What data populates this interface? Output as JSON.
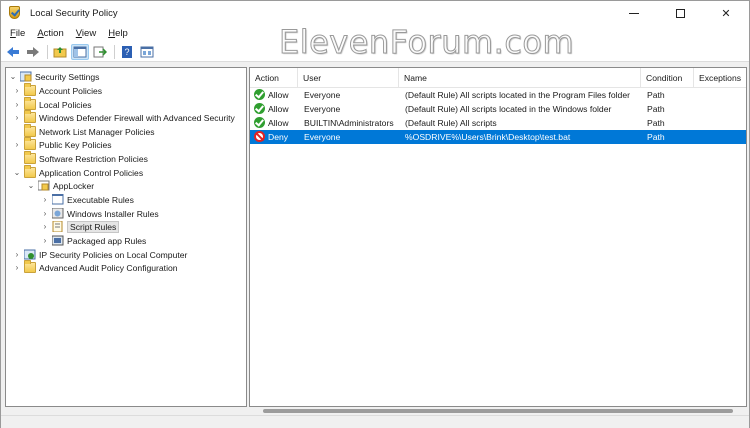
{
  "window": {
    "title": "Local Security Policy",
    "watermark": "ElevenForum.com"
  },
  "menu": [
    {
      "label": "File",
      "key": "F",
      "rest": "ile"
    },
    {
      "label": "Action",
      "key": "A",
      "rest": "ction"
    },
    {
      "label": "View",
      "key": "V",
      "rest": "iew"
    },
    {
      "label": "Help",
      "key": "H",
      "rest": "elp"
    }
  ],
  "toolbar": [
    "back-icon",
    "forward-icon",
    "up-folder-icon",
    "show-hide-tree-icon",
    "export-list-icon",
    "help-icon",
    "properties-icon"
  ],
  "tree": [
    {
      "label": "Security Settings",
      "level": 0,
      "expander": "down",
      "icon": "security-settings-icon"
    },
    {
      "label": "Account Policies",
      "level": 1,
      "expander": "right",
      "icon": "folder-icon"
    },
    {
      "label": "Local Policies",
      "level": 1,
      "expander": "right",
      "icon": "folder-icon"
    },
    {
      "label": "Windows Defender Firewall with Advanced Security",
      "level": 1,
      "expander": "right",
      "icon": "folder-icon"
    },
    {
      "label": "Network List Manager Policies",
      "level": 1,
      "expander": "none",
      "icon": "folder-icon"
    },
    {
      "label": "Public Key Policies",
      "level": 1,
      "expander": "right",
      "icon": "folder-icon"
    },
    {
      "label": "Software Restriction Policies",
      "level": 1,
      "expander": "none",
      "icon": "folder-icon"
    },
    {
      "label": "Application Control Policies",
      "level": 1,
      "expander": "down",
      "icon": "folder-icon"
    },
    {
      "label": "AppLocker",
      "level": 2,
      "expander": "down",
      "icon": "applocker-icon"
    },
    {
      "label": "Executable Rules",
      "level": 3,
      "expander": "right",
      "icon": "executable-rules-icon"
    },
    {
      "label": "Windows Installer Rules",
      "level": 3,
      "expander": "right",
      "icon": "installer-rules-icon"
    },
    {
      "label": "Script Rules",
      "level": 3,
      "expander": "right",
      "icon": "script-rules-icon",
      "selected": true
    },
    {
      "label": "Packaged app Rules",
      "level": 3,
      "expander": "right",
      "icon": "packaged-app-rules-icon"
    },
    {
      "label": "IP Security Policies on Local Computer",
      "level": 1,
      "expander": "right",
      "icon": "ip-security-icon"
    },
    {
      "label": "Advanced Audit Policy Configuration",
      "level": 1,
      "expander": "right",
      "icon": "folder-icon"
    }
  ],
  "list": {
    "columns": [
      "Action",
      "User",
      "Name",
      "Condition",
      "Exceptions"
    ],
    "rows": [
      {
        "action": "Allow",
        "action_icon": "allow-icon",
        "user": "Everyone",
        "name": "(Default Rule) All scripts located in the Program Files folder",
        "condition": "Path",
        "exceptions": ""
      },
      {
        "action": "Allow",
        "action_icon": "allow-icon",
        "user": "Everyone",
        "name": "(Default Rule) All scripts located in the Windows folder",
        "condition": "Path",
        "exceptions": ""
      },
      {
        "action": "Allow",
        "action_icon": "allow-icon",
        "user": "BUILTIN\\Administrators",
        "name": "(Default Rule) All scripts",
        "condition": "Path",
        "exceptions": ""
      },
      {
        "action": "Deny",
        "action_icon": "deny-icon",
        "user": "Everyone",
        "name": "%OSDRIVE%\\Users\\Brink\\Desktop\\test.bat",
        "condition": "Path",
        "exceptions": "",
        "selected": true
      }
    ]
  },
  "colors": {
    "selection": "#0078d7",
    "allow": "#2f9e2f",
    "deny": "#e02424"
  }
}
